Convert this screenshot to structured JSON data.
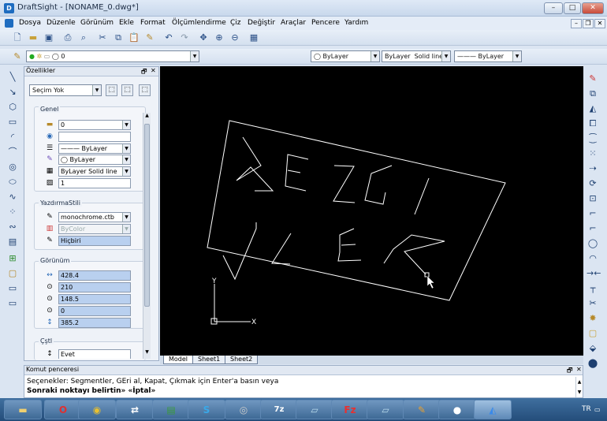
{
  "window": {
    "title": "DraftSight - [NONAME_0.dwg*]",
    "app_icon": "D"
  },
  "menu": [
    "Dosya",
    "Düzenle",
    "Görünüm",
    "Ekle",
    "Format",
    "Ölçümlendirme",
    "Çiz",
    "Değiştir",
    "Araçlar",
    "Pencere",
    "Yardım"
  ],
  "layer_toolbar": {
    "layer_value": "0"
  },
  "style_toolbar": {
    "color": "ByLayer",
    "linetype": "ByLayer",
    "linestyle": "Solid line",
    "lineweight": "——— ByLayer"
  },
  "properties_panel": {
    "title": "Özellikler",
    "selection": "Seçim Yok",
    "general": {
      "title": "Genel",
      "layer": "0",
      "color_field": "",
      "linetype": "——— ByLayer",
      "color": "◯ ByLayer",
      "linestyle": "ByLayer     Solid line",
      "scale": "1"
    },
    "print_style": {
      "title": "YazdırmaStili",
      "table": "monochrome.ctb",
      "style": "ByColor",
      "plot": "Hiçbiri"
    },
    "view": {
      "title": "Görünüm",
      "values": [
        "428.4",
        "210",
        "148.5",
        "0",
        "385.2"
      ]
    },
    "misc": {
      "title": "Çştl",
      "value": "Evet"
    }
  },
  "canvas": {
    "sketch_letters": "GEZGINLER",
    "axis_x": "X",
    "axis_y": "Y"
  },
  "sheet_tabs": [
    "Model",
    "Sheet1",
    "Sheet2"
  ],
  "command": {
    "title": "Komut penceresi",
    "line1": "Seçenekler: Segmentler, GEri al, Kapat, Çıkmak için Enter'a basın veya",
    "line2": "Sonraki noktayı belirtin» «İptal»"
  },
  "taskbar": {
    "locale": "TR",
    "apps": [
      "explorer",
      "opera",
      "chrome",
      "teamviewer",
      "spreadsheet",
      "skype",
      "disc",
      "7z",
      "notes",
      "filezilla",
      "notes2",
      "paint",
      "panda",
      "draftsight"
    ]
  }
}
